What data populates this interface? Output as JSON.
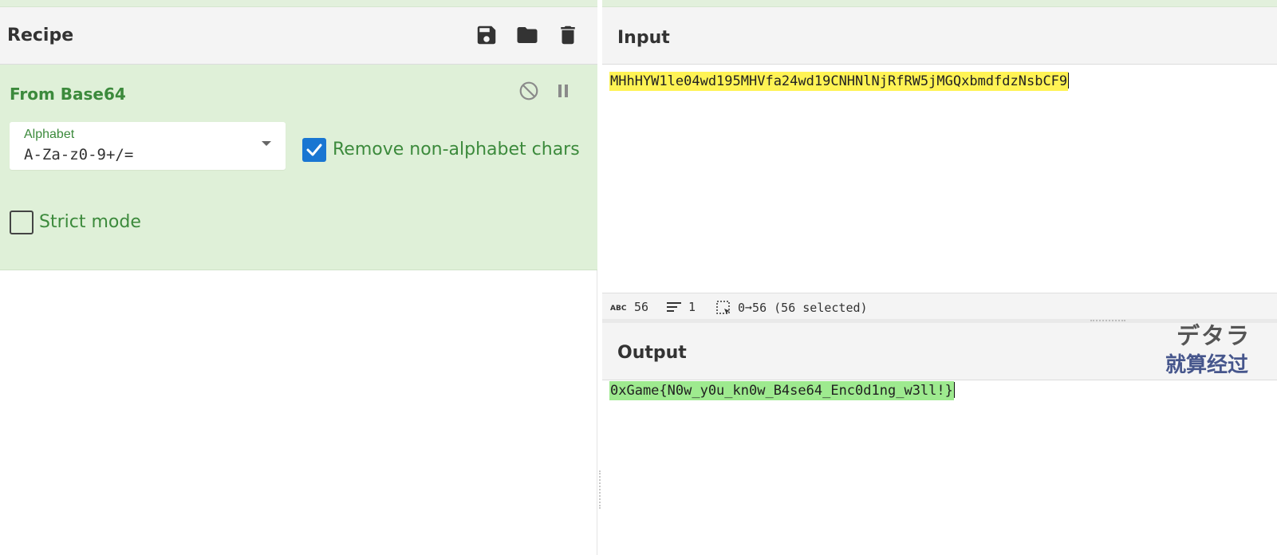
{
  "recipe": {
    "title": "Recipe",
    "save_icon": "save-icon",
    "folder_icon": "folder-icon",
    "delete_icon": "trash-icon"
  },
  "operation": {
    "title": "From Base64",
    "alphabet_label": "Alphabet",
    "alphabet_value": "A-Za-z0-9+/=",
    "remove_nonalpha_label": "Remove non-alphabet chars",
    "remove_nonalpha_checked": true,
    "strict_mode_label": "Strict mode",
    "strict_mode_checked": false
  },
  "input": {
    "title": "Input",
    "text": "MHhHYW1le04wd195MHVfa24wd19CNHNlNjRfRW5jMGQxbmdfdzNsbCF9"
  },
  "status_bar": {
    "length": "56",
    "lines": "1",
    "selection": "0➞56 (56 selected)"
  },
  "output": {
    "title": "Output",
    "text": "0xGame{N0w_y0u_kn0w_B4se64_Enc0d1ng_w3ll!}"
  },
  "overlay": {
    "line1": "デタラ",
    "line2": "就算经过"
  },
  "colors": {
    "accent_green": "#3c8a3c",
    "op_background": "#dff0d8",
    "checkbox_blue": "#1976d2",
    "input_highlight": "#fff354",
    "output_highlight": "#9eea8f"
  }
}
